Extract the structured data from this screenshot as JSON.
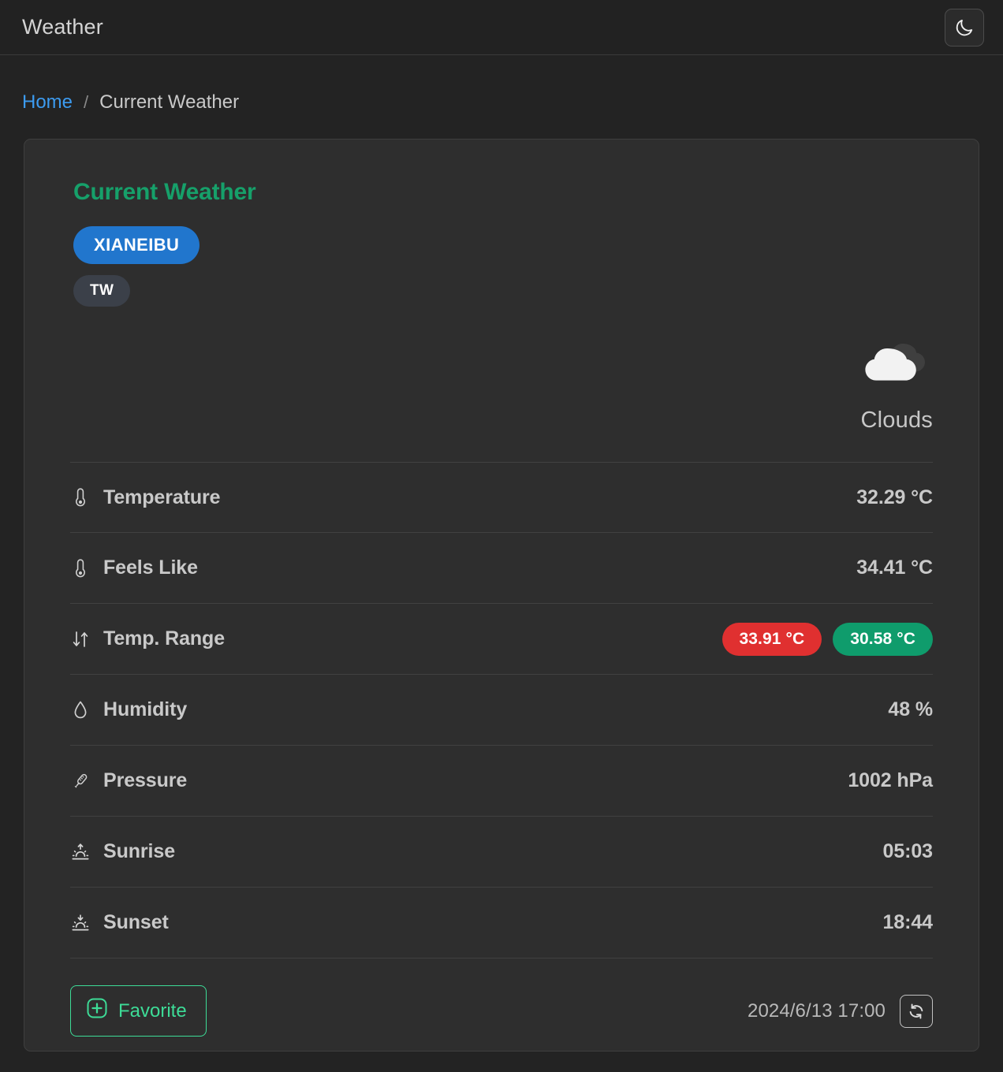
{
  "header": {
    "title": "Weather",
    "theme_toggle_icon": "moon-icon"
  },
  "breadcrumb": {
    "home_label": "Home",
    "separator": "/",
    "current_label": "Current Weather"
  },
  "card": {
    "title": "Current Weather",
    "badges": {
      "city": "XIANEIBU",
      "country": "TW"
    },
    "condition": {
      "icon": "clouds-icon",
      "label": "Clouds"
    },
    "rows": [
      {
        "icon": "thermometer-icon",
        "label": "Temperature",
        "value": "32.29 °C",
        "type": "text"
      },
      {
        "icon": "thermometer-icon",
        "label": "Feels Like",
        "value": "34.41 °C",
        "type": "text"
      },
      {
        "icon": "arrows-up-down-icon",
        "label": "Temp. Range",
        "type": "pills",
        "max": "33.91 °C",
        "min": "30.58 °C"
      },
      {
        "icon": "droplet-icon",
        "label": "Humidity",
        "value": "48 %",
        "type": "text"
      },
      {
        "icon": "tilted-thermometer-icon",
        "label": "Pressure",
        "value": "1002 hPa",
        "type": "text"
      },
      {
        "icon": "sunrise-icon",
        "label": "Sunrise",
        "value": "05:03",
        "type": "text"
      },
      {
        "icon": "sunset-icon",
        "label": "Sunset",
        "value": "18:44",
        "type": "text"
      }
    ],
    "footer": {
      "favorite_label": "Favorite",
      "favorite_icon": "plus-square-icon",
      "timestamp": "2024/6/13 17:00",
      "refresh_icon": "refresh-icon"
    }
  },
  "colors": {
    "page_bg": "#232323",
    "appbar_bg": "#222222",
    "card_bg": "#2e2e2e",
    "accent_green": "#16A06A",
    "link_blue": "#3c9bf0",
    "badge_blue": "#2176cd",
    "badge_gray": "#3b4049",
    "pill_red": "#e03030",
    "pill_green": "#0f9c6c",
    "favorite_green": "#3ddc97",
    "text_primary": "#c9c9c9"
  }
}
